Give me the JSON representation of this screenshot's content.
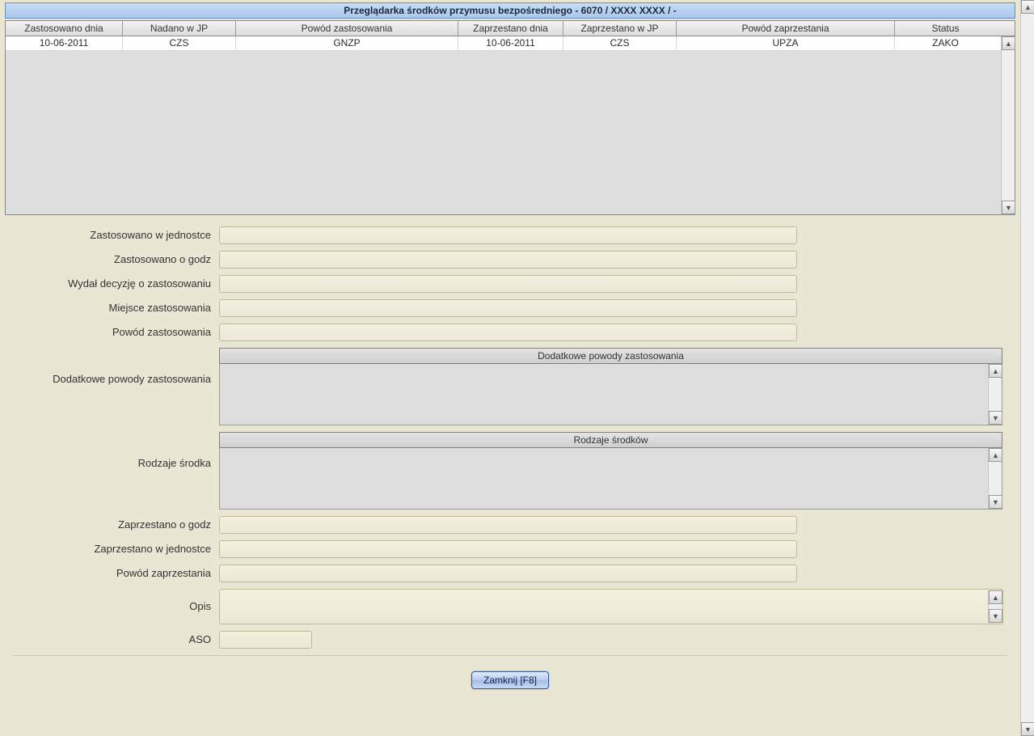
{
  "titleBar": "Przeglądarka środków przymusu bezpośredniego - 6070 / XXXX XXXX / -",
  "grid": {
    "headers": {
      "col1": "Zastosowano dnia",
      "col2": "Nadano w JP",
      "col3": "Powód zastosowania",
      "col4": "Zaprzestano dnia",
      "col5": "Zaprzestano w JP",
      "col6": "Powód zaprzestania",
      "col7": "Status"
    },
    "rows": [
      {
        "col1": "10-06-2011",
        "col2": "CZS",
        "col3": "GNZP",
        "col4": "10-06-2011",
        "col5": "CZS",
        "col6": "UPZA",
        "col7": "ZAKO"
      }
    ]
  },
  "form": {
    "labels": {
      "appliedUnit": "Zastosowano w jednostce",
      "appliedHour": "Zastosowano o godz",
      "decisionBy": "Wydał decyzję o zastosowaniu",
      "place": "Miejsce zastosowania",
      "reason": "Powód zastosowania",
      "additionalReasons": "Dodatkowe powody zastosowania",
      "typesOfMeans": "Rodzaje środka",
      "ceasedHour": "Zaprzestano o godz",
      "ceasedUnit": "Zaprzestano w jednostce",
      "ceaseReason": "Powód zaprzestania",
      "description": "Opis",
      "aso": "ASO"
    },
    "values": {
      "appliedUnit": "",
      "appliedHour": "",
      "decisionBy": "",
      "place": "",
      "reason": "",
      "ceasedHour": "",
      "ceasedUnit": "",
      "ceaseReason": "",
      "description": "",
      "aso": ""
    },
    "subHeaders": {
      "additionalReasons": "Dodatkowe powody zastosowania",
      "typesOfMeans": "Rodzaje środków"
    }
  },
  "buttons": {
    "close": "Zamknij [F8]"
  }
}
